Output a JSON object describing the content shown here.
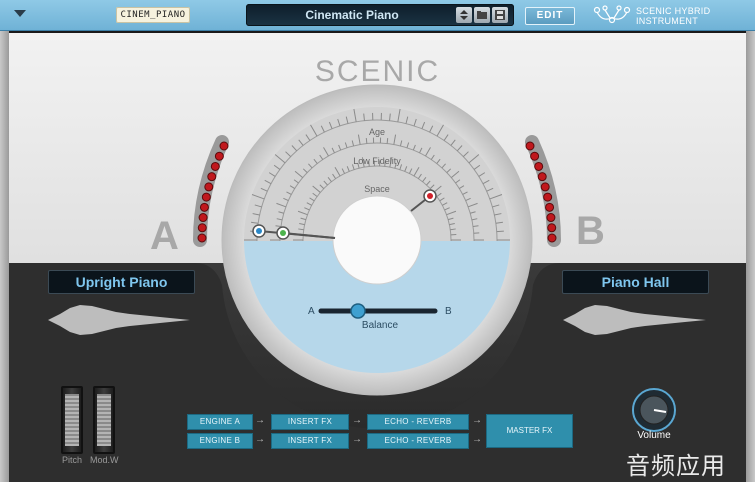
{
  "header": {
    "menu_icon": "triangle-down-icon",
    "preset_tag": "CINEM_PIANO",
    "preset_name": "Cinematic Piano",
    "edit_label": "EDIT",
    "logo_line1": "SCENIC HYBRID",
    "logo_line2": "INSTRUMENT"
  },
  "title": "SCENIC",
  "dial": {
    "labels": [
      "Age",
      "Low Fidelity",
      "Space"
    ],
    "balance_label": "Balance",
    "balance_a": "A",
    "balance_b": "B"
  },
  "layer_a": {
    "letter": "A",
    "name": "Upright Piano"
  },
  "layer_b": {
    "letter": "B",
    "name": "Piano Hall"
  },
  "controls": {
    "pitch_label": "Pitch",
    "modw_label": "Mod.W",
    "volume_label": "Volume"
  },
  "fx": {
    "row1": [
      "ENGINE A",
      "INSERT FX",
      "ECHO - REVERB"
    ],
    "row2": [
      "ENGINE B",
      "INSERT FX",
      "ECHO - REVERB"
    ],
    "master": "MASTER FX"
  },
  "watermark": "音频应用",
  "colors": {
    "accent": "#6fb2d6",
    "fx": "#2f8fac",
    "led": "#c0181d"
  }
}
